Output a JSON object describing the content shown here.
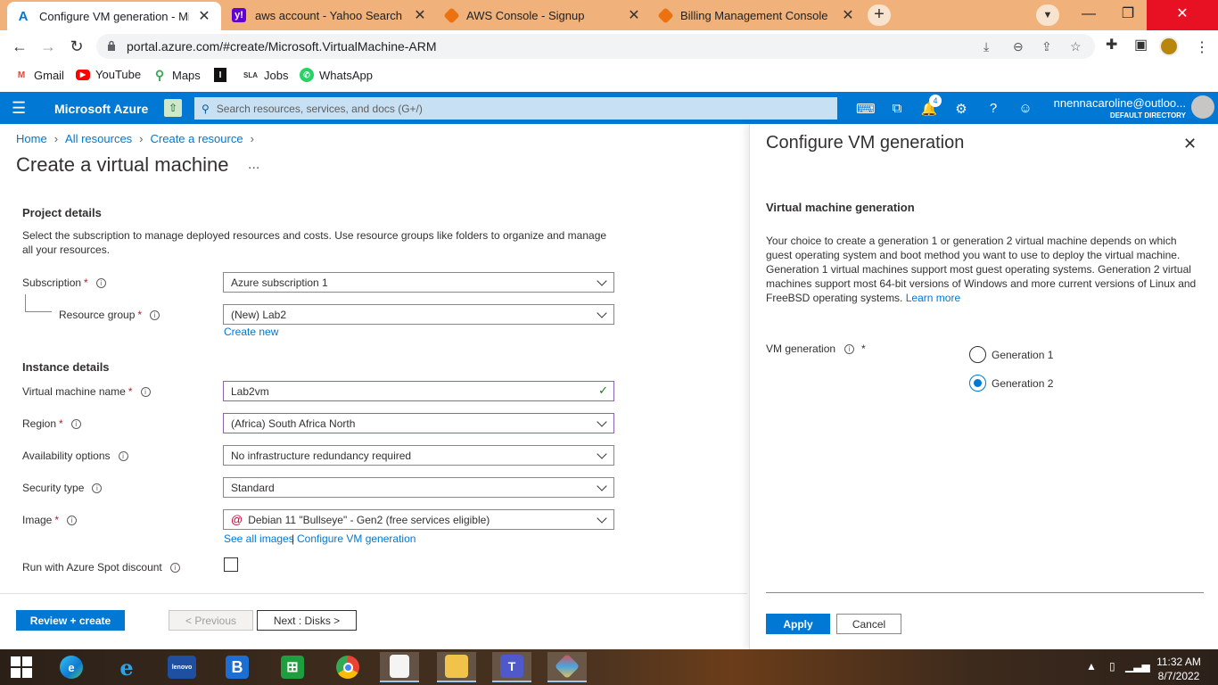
{
  "browser": {
    "tabs": [
      {
        "title": "Configure VM generation - Micro",
        "favicon": "azure-icon",
        "color": "#0078d4",
        "active": true
      },
      {
        "title": "aws account - Yahoo Search Resu",
        "favicon": "yahoo-icon",
        "color": "#6001d2",
        "active": false
      },
      {
        "title": "AWS Console - Signup",
        "favicon": "aws-cube-icon",
        "color": "#ec7211",
        "active": false
      },
      {
        "title": "Billing Management Console",
        "favicon": "aws-cube-icon",
        "color": "#ec7211",
        "active": false
      }
    ],
    "url": "portal.azure.com/#create/Microsoft.VirtualMachine-ARM",
    "bookmarks": [
      {
        "label": "Gmail",
        "icon": "gmail-icon"
      },
      {
        "label": "YouTube",
        "icon": "youtube-icon"
      },
      {
        "label": "Maps",
        "icon": "maps-icon"
      },
      {
        "label": "",
        "icon": "bookmark-i-icon"
      },
      {
        "label": "Jobs",
        "icon": "sla-jobs-icon"
      },
      {
        "label": "WhatsApp",
        "icon": "whatsapp-icon"
      }
    ],
    "sla_text": "SLA"
  },
  "azure": {
    "brand": "Microsoft Azure",
    "search_placeholder": "Search resources, services, and docs (G+/)",
    "notifications_count": "4",
    "account_email": "nnennacaroline@outloo...",
    "directory": "DEFAULT DIRECTORY"
  },
  "breadcrumb": [
    "Home",
    "All resources",
    "Create a resource"
  ],
  "page": {
    "title": "Create a virtual machine",
    "more": "...",
    "project_details": "Project details",
    "project_desc": "Select the subscription to manage deployed resources and costs. Use resource groups like folders to organize and manage all your resources.",
    "subscription_label": "Subscription",
    "subscription_value": "Azure subscription 1",
    "rg_label": "Resource group",
    "rg_value": "(New) Lab2",
    "create_new": "Create new",
    "instance_details": "Instance details",
    "vmname_label": "Virtual machine name",
    "vmname_value": "Lab2vm",
    "region_label": "Region",
    "region_value": "(Africa) South Africa North",
    "availability_label": "Availability options",
    "availability_value": "No infrastructure redundancy required",
    "security_label": "Security type",
    "security_value": "Standard",
    "image_label": "Image",
    "image_value": "Debian 11 \"Bullseye\" - Gen2 (free services eligible)",
    "see_all_images": "See all images",
    "link_sep": "|",
    "configure_vm_gen": "Configure VM generation",
    "spot_label": "Run with Azure Spot discount",
    "spot_checked": false,
    "review_create": "Review + create",
    "previous": "< Previous",
    "next_disks": "Next : Disks >"
  },
  "panel": {
    "title": "Configure VM generation",
    "subtitle": "Virtual machine generation",
    "description": "Your choice to create a generation 1 or generation 2 virtual machine depends on which guest operating system and boot method you want to use to deploy the virtual machine. Generation 1 virtual machines support most guest operating systems. Generation 2 virtual machines support most 64-bit versions of Windows and more current versions of Linux and FreeBSD operating systems.",
    "learn_more": "Learn more",
    "vm_generation_label": "VM generation",
    "required_mark": "*",
    "options": [
      "Generation 1",
      "Generation 2"
    ],
    "selected": "Generation 2",
    "apply": "Apply",
    "cancel": "Cancel"
  },
  "taskbar": {
    "time": "11:32 AM",
    "date": "8/7/2022",
    "lenovo_label": "lenovo",
    "apps": [
      "windows-start-icon",
      "edge-icon",
      "internet-explorer-icon",
      "lenovo-icon",
      "b-app-icon",
      "store-icon",
      "chrome-icon",
      "notepad-icon",
      "file-explorer-icon",
      "teams-icon",
      "app-icon"
    ]
  },
  "colors": {
    "azure_blue": "#0078d4",
    "tab_strip": "#f0b27a",
    "close_red": "#e81123"
  }
}
